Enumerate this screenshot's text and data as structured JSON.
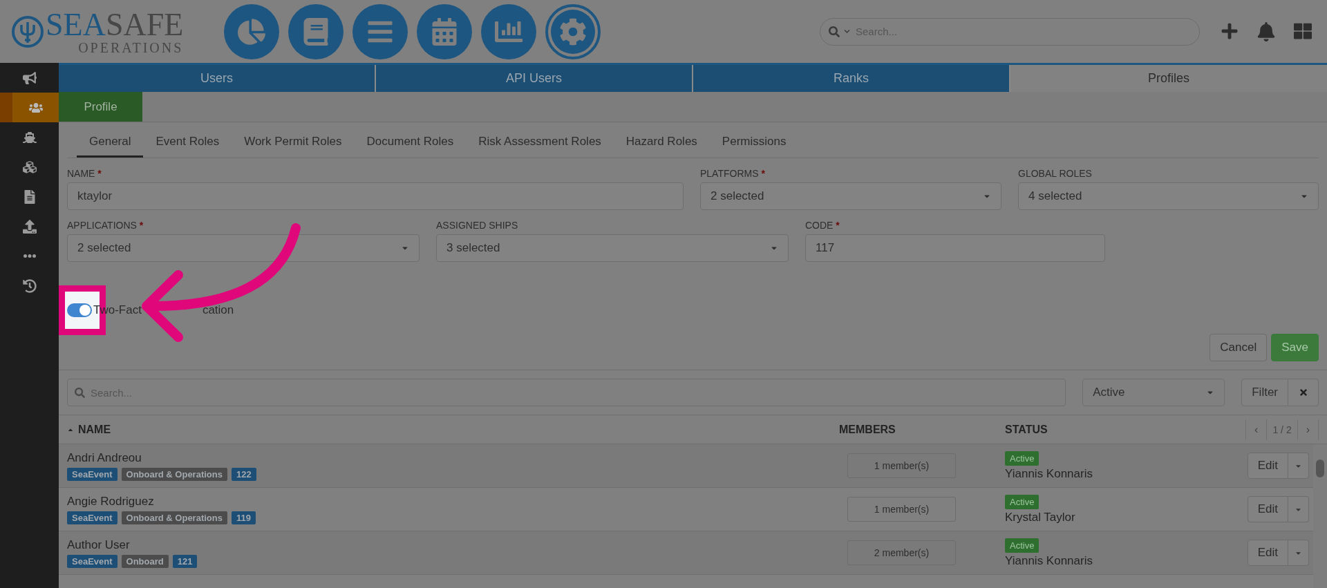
{
  "logo": {
    "name_first": "SEA",
    "name_second": "SAFE",
    "subtitle": "OPERATIONS"
  },
  "nav": [
    {
      "selected": false
    },
    {
      "selected": false
    },
    {
      "selected": false
    },
    {
      "selected": false
    },
    {
      "selected": false
    },
    {
      "selected": true
    }
  ],
  "global_search": {
    "placeholder": "Search..."
  },
  "sidebar": {
    "items": [
      {
        "selected": false
      },
      {
        "selected": true
      },
      {
        "selected": false
      },
      {
        "selected": false
      },
      {
        "selected": false
      },
      {
        "selected": false
      },
      {
        "selected": false
      },
      {
        "selected": false
      }
    ]
  },
  "tabs": [
    {
      "label": "Users",
      "selected": false
    },
    {
      "label": "API Users",
      "selected": false
    },
    {
      "label": "Ranks",
      "selected": false
    },
    {
      "label": "Profiles",
      "selected": true
    }
  ],
  "subtab": "Profile",
  "inner_tabs": [
    {
      "label": "General",
      "selected": true
    },
    {
      "label": "Event Roles",
      "selected": false
    },
    {
      "label": "Work Permit Roles",
      "selected": false
    },
    {
      "label": "Document Roles",
      "selected": false
    },
    {
      "label": "Risk Assessment Roles",
      "selected": false
    },
    {
      "label": "Hazard Roles",
      "selected": false
    },
    {
      "label": "Permissions",
      "selected": false
    }
  ],
  "form_rows": [
    [
      {
        "label": "NAME",
        "required_mark": "*",
        "kind": "text",
        "value": "ktaylor"
      },
      {
        "label": "PLATFORMS",
        "required_mark": "*",
        "kind": "select",
        "value": "2 selected"
      },
      {
        "label": "GLOBAL ROLES",
        "kind": "select",
        "value": "4 selected"
      }
    ],
    [
      {
        "label": "APPLICATIONS",
        "required_mark": "*",
        "kind": "select",
        "value": "2 selected"
      },
      {
        "label": "ASSIGNED SHIPS",
        "kind": "select",
        "value": "3 selected"
      },
      {
        "label": "CODE",
        "required_mark": "*",
        "kind": "text",
        "value": "117"
      }
    ]
  ],
  "two_factor": {
    "checked": true,
    "label_parts": [
      "Two-Fact",
      "cation"
    ]
  },
  "buttons": [
    {
      "label": "Cancel",
      "kind": "secondary"
    },
    {
      "label": "Save",
      "kind": "primary"
    }
  ],
  "list_search": {
    "placeholder": "Search..."
  },
  "status_filter": {
    "value": "Active"
  },
  "filter_button": "Filter",
  "table": {
    "columns": [
      "NAME",
      "MEMBERS",
      "STATUS"
    ],
    "pager": {
      "prev": "‹",
      "page": "1 / 2",
      "next": "›"
    },
    "rows": [
      {
        "name": "Andri Andreou",
        "tags": [
          {
            "text": "SeaEvent",
            "kind": "app"
          },
          {
            "text": "Onboard & Operations",
            "kind": "platform"
          },
          {
            "text": "122",
            "kind": "code"
          }
        ],
        "members": "1 member(s)",
        "status": "Active",
        "owner": "Yiannis Konnaris",
        "action": "Edit"
      },
      {
        "name": "Angie Rodriguez",
        "tags": [
          {
            "text": "SeaEvent",
            "kind": "app"
          },
          {
            "text": "Onboard & Operations",
            "kind": "platform"
          },
          {
            "text": "119",
            "kind": "code"
          }
        ],
        "members": "1 member(s)",
        "status": "Active",
        "owner": "Krystal Taylor",
        "action": "Edit"
      },
      {
        "name": "Author User",
        "tags": [
          {
            "text": "SeaEvent",
            "kind": "app"
          },
          {
            "text": "Onboard",
            "kind": "platform"
          },
          {
            "text": "121",
            "kind": "code"
          }
        ],
        "members": "2 member(s)",
        "status": "Active",
        "owner": "Yiannis Konnaris",
        "action": "Edit"
      }
    ]
  }
}
